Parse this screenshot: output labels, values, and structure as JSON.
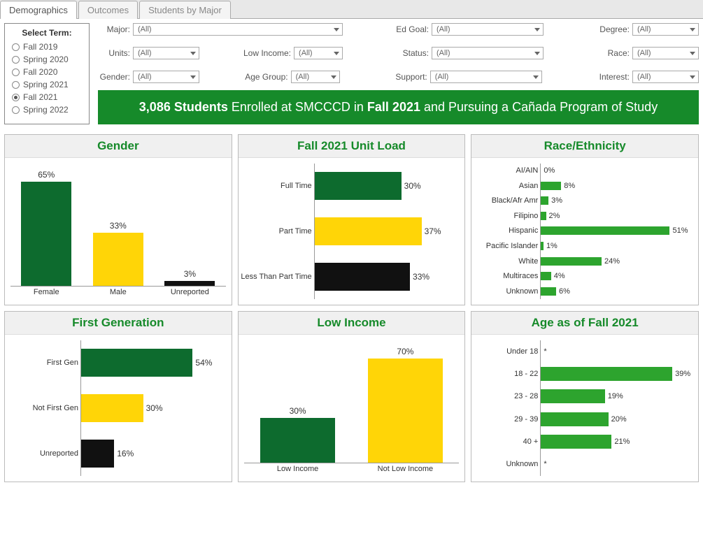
{
  "tabs": [
    "Demographics",
    "Outcomes",
    "Students by Major"
  ],
  "active_tab": 0,
  "term_box": {
    "title": "Select Term:",
    "items": [
      "Fall 2019",
      "Spring 2020",
      "Fall 2020",
      "Spring 2021",
      "Fall 2021",
      "Spring 2022"
    ],
    "selected": 4
  },
  "filters": {
    "row1": {
      "major": {
        "label": "Major:",
        "value": "(All)"
      },
      "edgoal": {
        "label": "Ed Goal:",
        "value": "(All)"
      },
      "degree": {
        "label": "Degree:",
        "value": "(All)"
      }
    },
    "row2": {
      "units": {
        "label": "Units:",
        "value": "(All)"
      },
      "lowincome": {
        "label": "Low Income:",
        "value": "(All)"
      },
      "status": {
        "label": "Status:",
        "value": "(All)"
      },
      "race": {
        "label": "Race:",
        "value": "(All)"
      }
    },
    "row3": {
      "gender": {
        "label": "Gender:",
        "value": "(All)"
      },
      "agegroup": {
        "label": "Age Group:",
        "value": "(All)"
      },
      "support": {
        "label": "Support:",
        "value": "(All)"
      },
      "interest": {
        "label": "Interest:",
        "value": "(All)"
      }
    }
  },
  "banner": {
    "count": "3,086 Students",
    "mid1": " Enrolled at SMCCCD in ",
    "term": "Fall 2021",
    "mid2": " and Pursuing a Cañada Program of Study"
  },
  "chart_data": [
    {
      "id": "gender",
      "title": "Gender",
      "type": "bar",
      "orientation": "vertical",
      "categories": [
        "Female",
        "Male",
        "Unreported"
      ],
      "values": [
        65,
        33,
        3
      ],
      "labels": [
        "65%",
        "33%",
        "3%"
      ],
      "colors": [
        "green",
        "yellow",
        "black"
      ]
    },
    {
      "id": "unitload",
      "title": "Fall 2021 Unit Load",
      "type": "bar",
      "orientation": "horizontal",
      "categories": [
        "Full Time",
        "Part Time",
        "Less Than Part Time"
      ],
      "values": [
        30,
        37,
        33
      ],
      "labels": [
        "30%",
        "37%",
        "33%"
      ],
      "colors": [
        "green",
        "yellow",
        "black"
      ],
      "xlim": [
        0,
        50
      ]
    },
    {
      "id": "race",
      "title": "Race/Ethnicity",
      "type": "bar",
      "orientation": "horizontal",
      "categories": [
        "AI/AIN",
        "Asian",
        "Black/Afr Amr",
        "Filipino",
        "Hispanic",
        "Pacific Islander",
        "White",
        "Multiraces",
        "Unknown"
      ],
      "values": [
        0,
        8,
        3,
        2,
        51,
        1,
        24,
        4,
        6
      ],
      "labels": [
        "0%",
        "8%",
        "3%",
        "2%",
        "51%",
        "1%",
        "24%",
        "4%",
        "6%"
      ],
      "colors": [
        "brightgreen",
        "brightgreen",
        "brightgreen",
        "brightgreen",
        "brightgreen",
        "brightgreen",
        "brightgreen",
        "brightgreen",
        "brightgreen"
      ],
      "xlim": [
        0,
        60
      ]
    },
    {
      "id": "firstgen",
      "title": "First Generation",
      "type": "bar",
      "orientation": "horizontal",
      "categories": [
        "First Gen",
        "Not First Gen",
        "Unreported"
      ],
      "values": [
        54,
        30,
        16
      ],
      "labels": [
        "54%",
        "30%",
        "16%"
      ],
      "colors": [
        "green",
        "yellow",
        "black"
      ],
      "xlim": [
        0,
        70
      ]
    },
    {
      "id": "lowincome",
      "title": "Low Income",
      "type": "bar",
      "orientation": "vertical",
      "categories": [
        "Low Income",
        "Not Low Income"
      ],
      "values": [
        30,
        70
      ],
      "labels": [
        "30%",
        "70%"
      ],
      "colors": [
        "green",
        "yellow"
      ]
    },
    {
      "id": "age",
      "title": "Age as of Fall 2021",
      "type": "bar",
      "orientation": "horizontal",
      "categories": [
        "Under 18",
        "18 - 22",
        "23 - 28",
        "29 - 39",
        "40 +",
        "Unknown"
      ],
      "values": [
        0,
        39,
        19,
        20,
        21,
        0
      ],
      "labels": [
        "*",
        "39%",
        "19%",
        "20%",
        "21%",
        "*"
      ],
      "colors": [
        "brightgreen",
        "brightgreen",
        "brightgreen",
        "brightgreen",
        "brightgreen",
        "brightgreen"
      ],
      "xlim": [
        0,
        45
      ],
      "bar_thick": 20
    }
  ],
  "colors": {
    "green": "#0d6b2e",
    "brightgreen": "#2da42e",
    "yellow": "#ffd507",
    "black": "#111111"
  }
}
